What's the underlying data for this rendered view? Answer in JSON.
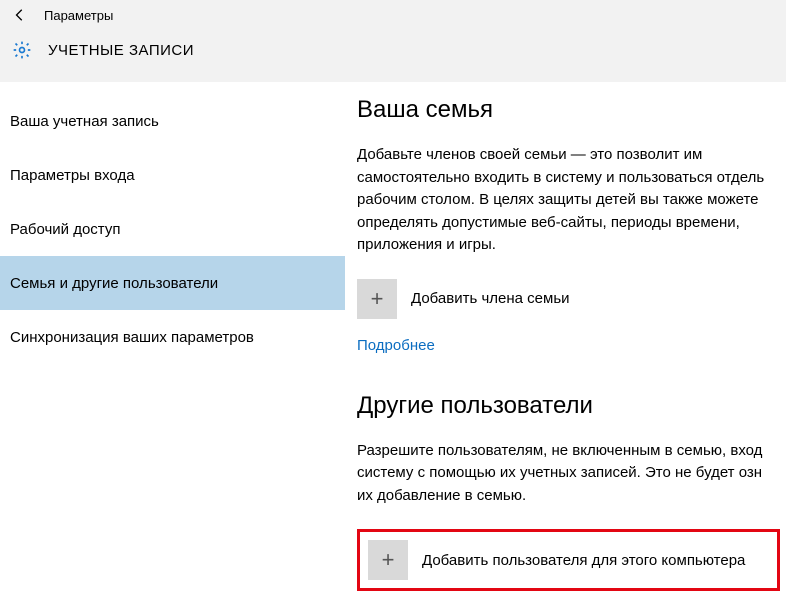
{
  "titlebar": {
    "label": "Параметры"
  },
  "header": {
    "title": "УЧЕТНЫЕ ЗАПИСИ"
  },
  "sidebar": {
    "items": [
      {
        "label": "Ваша учетная запись",
        "selected": false
      },
      {
        "label": "Параметры входа",
        "selected": false
      },
      {
        "label": "Рабочий доступ",
        "selected": false
      },
      {
        "label": "Семья и другие пользователи",
        "selected": true
      },
      {
        "label": "Синхронизация ваших параметров",
        "selected": false
      }
    ]
  },
  "content": {
    "family": {
      "title": "Ваша семья",
      "text": "Добавьте членов своей семьи — это позволит им самостоятельно входить в систему и пользоваться отдель рабочим столом. В целях защиты детей вы также можете определять допустимые веб-сайты, периоды времени, приложения и игры.",
      "add_label": "Добавить члена семьи",
      "learn_more": "Подробнее"
    },
    "others": {
      "title": "Другие пользователи",
      "text": "Разрешите пользователям, не включенным в семью, вход систему с помощью их учетных записей. Это не будет озн их добавление в семью.",
      "add_label": "Добавить пользователя для этого компьютера"
    }
  }
}
